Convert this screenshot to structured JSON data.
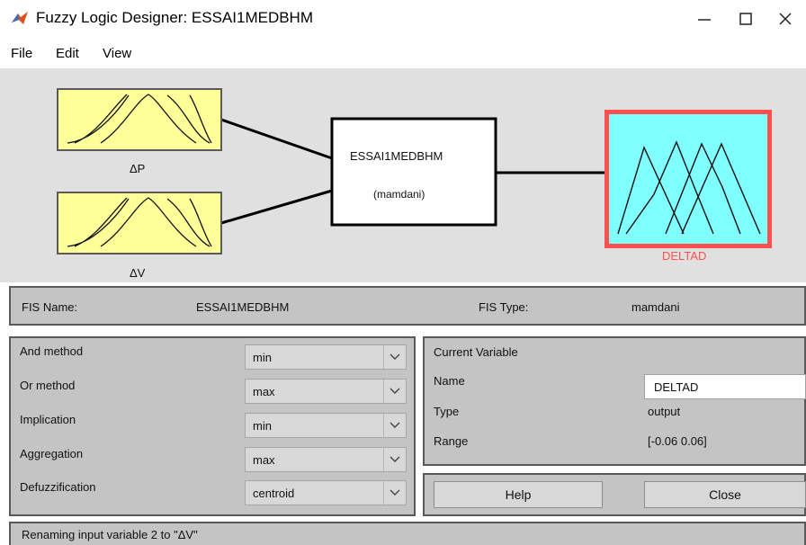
{
  "window": {
    "title": "Fuzzy Logic Designer: ESSAI1MEDBHM",
    "minimize_icon": "minimize-icon",
    "maximize_icon": "maximize-icon",
    "close_icon": "close-icon"
  },
  "menu": {
    "file": "File",
    "edit": "Edit",
    "view": "View"
  },
  "diagram": {
    "input1": "ΔP",
    "input2": "ΔV",
    "system_name": "ESSAI1MEDBHM",
    "system_type": "(mamdani)",
    "output": "DELTAD",
    "colors": {
      "input_fill": "#ffff99",
      "output_fill": "#80ffff",
      "selected_border": "#ff5050",
      "output_label": "#ff5050"
    }
  },
  "fis": {
    "name_label": "FIS Name:",
    "name_value": "ESSAI1MEDBHM",
    "type_label": "FIS Type:",
    "type_value": "mamdani"
  },
  "methods": [
    {
      "label": "And method",
      "value": "min"
    },
    {
      "label": "Or method",
      "value": "max"
    },
    {
      "label": "Implication",
      "value": "min"
    },
    {
      "label": "Aggregation",
      "value": "max"
    },
    {
      "label": "Defuzzification",
      "value": "centroid"
    }
  ],
  "current_variable": {
    "heading": "Current Variable",
    "name_label": "Name",
    "name_value": "DELTAD",
    "type_label": "Type",
    "type_value": "output",
    "range_label": "Range",
    "range_value": "[-0.06 0.06]"
  },
  "buttons": {
    "help": "Help",
    "close": "Close"
  },
  "status": "Renaming input variable 2 to \"ΔV\""
}
